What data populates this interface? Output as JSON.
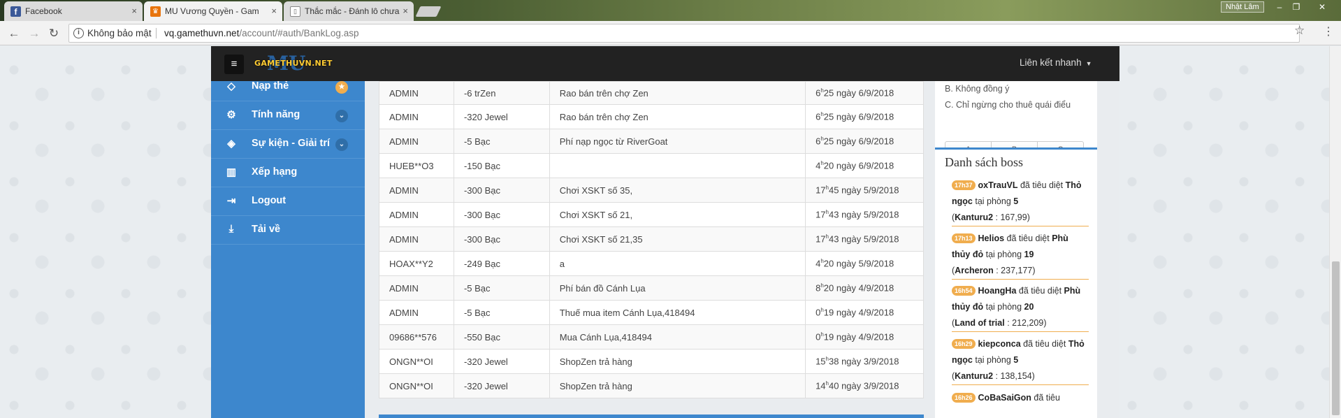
{
  "browser": {
    "tabs": [
      {
        "title": "Facebook",
        "favicon_color": "#3b5998",
        "favicon_glyph": "f",
        "active": false
      },
      {
        "title": "MU Vương Quyền - Gam",
        "favicon_color": "#e8740c",
        "favicon_glyph": "♛",
        "active": true
      },
      {
        "title": "Thắc mắc - Đánh lô chưa",
        "favicon_color": "#ffffff",
        "favicon_glyph": "▯",
        "active": false
      }
    ],
    "tab_close": "×",
    "window_user": "Nhật Lâm",
    "window_buttons": {
      "minimize": "–",
      "restore": "❐",
      "close": "✕"
    },
    "nav": {
      "back": "←",
      "forward": "→",
      "reload": "↻"
    },
    "security_label": "Không bảo mật",
    "url_host": "vq.gamethuvn.net",
    "url_path": "/account/#auth/BankLog.asp",
    "star": "☆",
    "menu": "⋮"
  },
  "header": {
    "menu_icon": "≡",
    "logo_text": "GAMETHUVN.NET",
    "logo_mu": "MU",
    "quick_links": "Liên kết nhanh",
    "caret": "▼"
  },
  "sidebar": {
    "items": [
      {
        "label": "Nạp thẻ",
        "icon": "diamond-icon",
        "glyph": "◇",
        "badge": "★",
        "badge_type": "star"
      },
      {
        "label": "Tính năng",
        "icon": "gears-icon",
        "glyph": "⚙",
        "badge": "⌄",
        "badge_type": "chev"
      },
      {
        "label": "Sự kiện - Giải trí",
        "icon": "tags-icon",
        "glyph": "◈",
        "badge": "⌄",
        "badge_type": "chev"
      },
      {
        "label": "Xếp hạng",
        "icon": "bar-chart-icon",
        "glyph": "▥",
        "badge": "",
        "badge_type": ""
      },
      {
        "label": "Logout",
        "icon": "sign-out-icon",
        "glyph": "⇥",
        "badge": "",
        "badge_type": ""
      },
      {
        "label": "Tải về",
        "icon": "download-icon",
        "glyph": "⤓",
        "badge": "",
        "badge_type": ""
      }
    ]
  },
  "bank_log": {
    "rows": [
      {
        "account": "ADMIN",
        "amount": "-6  trZen",
        "note": "Rao bán trên chợ Zen",
        "hour": "6",
        "min": "25 ngày 6/9/2018"
      },
      {
        "account": "ADMIN",
        "amount": "-320  Jewel",
        "note": "Rao bán trên chợ Zen",
        "hour": "6",
        "min": "25 ngày 6/9/2018"
      },
      {
        "account": "ADMIN",
        "amount": "-5  Bạc",
        "note": "Phí nạp ngọc từ RiverGoat",
        "hour": "6",
        "min": "25 ngày 6/9/2018"
      },
      {
        "account": "HUEB**O3",
        "amount": "-150  Bạc",
        "note": "",
        "hour": "4",
        "min": "20 ngày 6/9/2018"
      },
      {
        "account": "ADMIN",
        "amount": "-300  Bạc",
        "note": "Chơi XSKT số 35,",
        "hour": "17",
        "min": "45 ngày 5/9/2018"
      },
      {
        "account": "ADMIN",
        "amount": "-300  Bạc",
        "note": "Chơi XSKT số 21,",
        "hour": "17",
        "min": "43 ngày 5/9/2018"
      },
      {
        "account": "ADMIN",
        "amount": "-300  Bạc",
        "note": "Chơi XSKT số 21,35",
        "hour": "17",
        "min": "43 ngày 5/9/2018"
      },
      {
        "account": "HOAX**Y2",
        "amount": "-249  Bạc",
        "note": "a",
        "hour": "4",
        "min": "20 ngày 5/9/2018"
      },
      {
        "account": "ADMIN",
        "amount": "-5  Bạc",
        "note": "Phí bán đồ Cánh Lụa",
        "hour": "8",
        "min": "20 ngày 4/9/2018"
      },
      {
        "account": "ADMIN",
        "amount": "-5  Bạc",
        "note": "Thuế mua item Cánh Lụa,418494",
        "hour": "0",
        "min": "19 ngày 4/9/2018"
      },
      {
        "account": "09686**576",
        "amount": "-550  Bạc",
        "note": "Mua Cánh Lụa,418494",
        "hour": "0",
        "min": "19 ngày 4/9/2018"
      },
      {
        "account": "ONGN**OI",
        "amount": "-320  Jewel",
        "note": "ShopZen trả hàng",
        "hour": "15",
        "min": "38 ngày 3/9/2018"
      },
      {
        "account": "ONGN**OI",
        "amount": "-320  Jewel",
        "note": "ShopZen trả hàng",
        "hour": "14",
        "min": "40 ngày 3/9/2018"
      }
    ],
    "hour_sup": "h"
  },
  "poll": {
    "options": [
      "B. Không đồng ý",
      "C. Chỉ ngừng cho thuê quái điểu"
    ],
    "buttons": [
      "A",
      "B",
      "C"
    ]
  },
  "boss_list": {
    "title": "Danh sách boss",
    "entries": [
      {
        "time": "17h37",
        "player": "oxTrauVL",
        "verb": "đã tiêu diệt",
        "boss": "Thỏ ngọc",
        "room_label": "tại phòng",
        "room": "5",
        "map": "Kanturu2",
        "coords": ": 167,99)"
      },
      {
        "time": "17h13",
        "player": "Helios",
        "verb": "đã tiêu diệt",
        "boss": "Phù thủy đỏ",
        "room_label": "tại phòng",
        "room": "19",
        "map": "Archeron",
        "coords": ": 237,177)"
      },
      {
        "time": "16h54",
        "player": "HoangHa",
        "verb": "đã tiêu diệt",
        "boss": "Phù thủy đỏ",
        "room_label": "tại phòng",
        "room": "20",
        "map": "Land of trial",
        "coords": ": 212,209)"
      },
      {
        "time": "16h29",
        "player": "kiepconca",
        "verb": "đã tiêu diệt",
        "boss": "Thỏ ngọc",
        "room_label": "tại phòng",
        "room": "5",
        "map": "Kanturu2",
        "coords": ": 138,154)"
      },
      {
        "time": "16h26",
        "player": "CoBaSaiGon",
        "verb": "đã tiêu",
        "boss": "",
        "room_label": "",
        "room": "",
        "map": "",
        "coords": ""
      }
    ]
  },
  "colors": {
    "sidebar_bg": "#3d87cd",
    "header_bg": "#222222",
    "accent_orange": "#f0ad4e"
  }
}
